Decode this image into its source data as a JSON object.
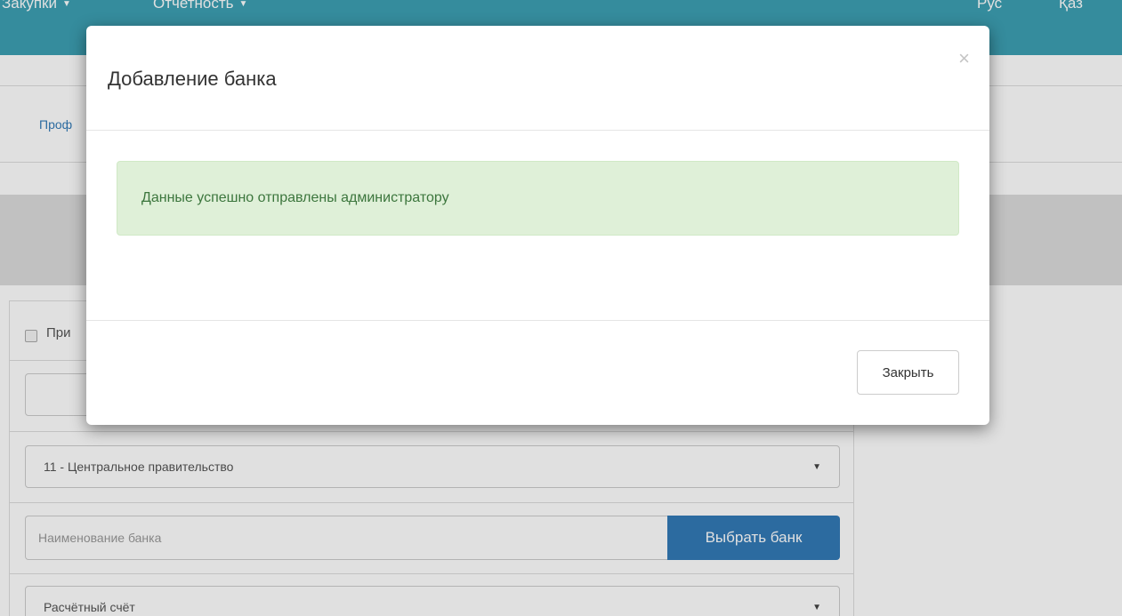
{
  "navbar": {
    "items": [
      {
        "label": "Закупки"
      },
      {
        "label": "Отчетность"
      }
    ],
    "lang": {
      "rus": "Рус",
      "kaz": "Қаз"
    }
  },
  "subnav": {
    "link_label": "Проф"
  },
  "form": {
    "checkbox_label": "При",
    "govt_select_value": "11 - Центральное правительство",
    "bank_placeholder": "Наименование банка",
    "bank_button": "Выбрать банк",
    "account_select_value": "Расчётный счёт"
  },
  "modal": {
    "title": "Добавление банка",
    "close_glyph": "×",
    "alert_text": "Данные успешно отправлены администратору",
    "close_button": "Закрыть"
  }
}
